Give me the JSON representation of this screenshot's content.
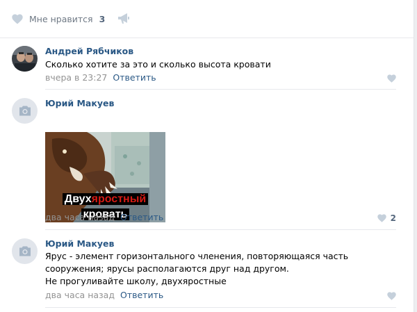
{
  "post_footer": {
    "like_label": "Мне нравится",
    "like_count": "3",
    "icons": {
      "like": "heart-icon",
      "share": "megaphone-icon"
    }
  },
  "comments": [
    {
      "author": "Андрей Рябчиков",
      "avatar": "user-photo",
      "lines": [
        "Сколько хотите за это и сколько высота кровати"
      ],
      "date": "вчера в 23:27",
      "reply_label": "Ответить",
      "likes": ""
    },
    {
      "author": "Юрий Макуев",
      "avatar": "camera-placeholder-icon",
      "image": {
        "caption_line1_part1": "Двух",
        "caption_line1_part2": "яростный",
        "caption_line2": "кровать"
      },
      "lines": [],
      "date": "два часа назад",
      "reply_label": "Ответить",
      "likes": "2"
    },
    {
      "author": "Юрий Макуев",
      "avatar": "camera-placeholder-icon",
      "lines": [
        "Ярус - элемент горизонтального членения, повторяющаяся часть",
        "сооружения; ярусы располагаются друг над другом.",
        "Не прогуливайте школу, двухяростные"
      ],
      "date": "два часа назад",
      "reply_label": "Ответить",
      "likes": ""
    }
  ],
  "colors": {
    "link": "#2a5885",
    "muted": "#939393",
    "icon": "#c5d0db",
    "page_bg": "#edeef0",
    "meme_red": "#d51a14"
  }
}
